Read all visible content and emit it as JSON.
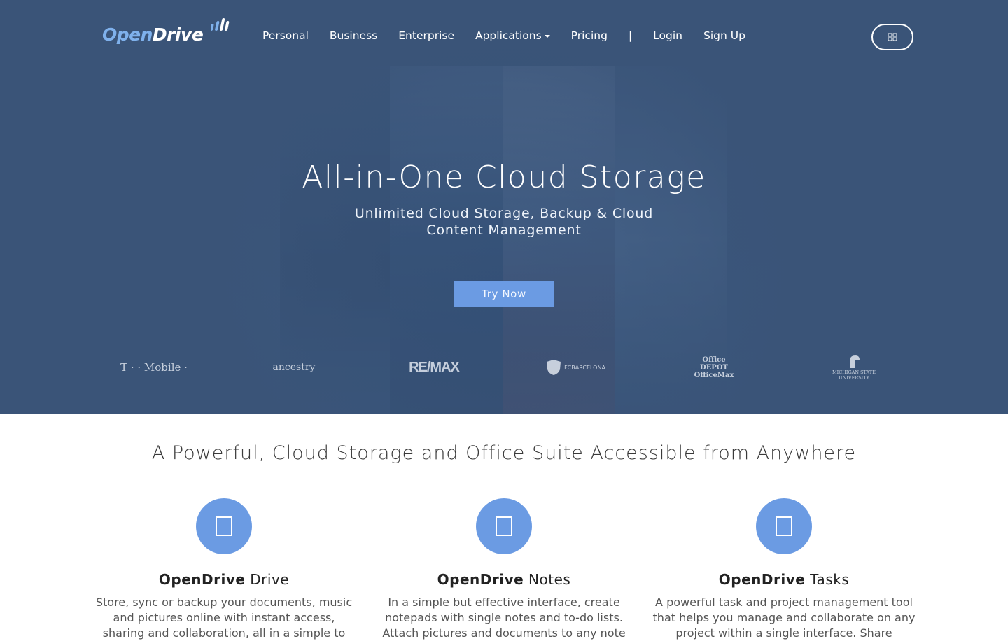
{
  "brand": {
    "logo_open": "Open",
    "logo_drive": "Drive"
  },
  "nav": {
    "items": [
      {
        "label": "Personal"
      },
      {
        "label": "Business"
      },
      {
        "label": "Enterprise"
      },
      {
        "label": "Applications"
      },
      {
        "label": "Pricing"
      },
      {
        "label": "|"
      },
      {
        "label": "Login"
      },
      {
        "label": "Sign Up"
      }
    ],
    "toggle_icon": "grid-icon"
  },
  "hero": {
    "title": "All-in-One Cloud Storage",
    "subtitle": "Unlimited Cloud Storage, Backup & Cloud Content Management",
    "cta": "Try Now"
  },
  "clients": [
    {
      "name": "T · · Mobile ·"
    },
    {
      "name": "ancestry"
    },
    {
      "name": "RE/MAX"
    },
    {
      "name": "FCBARCELONA"
    },
    {
      "name": "Office DEPOT OfficeMax"
    },
    {
      "name": "MICHIGAN STATE UNIVERSITY"
    }
  ],
  "features": {
    "title": "A Powerful, Cloud Storage and Office Suite Accessible from Anywhere",
    "items": [
      {
        "brand": "OpenDrive",
        "name": " Drive",
        "icon": "cloud-icon",
        "desc": "Store, sync or backup your documents, music and pictures online with instant access, sharing and collaboration, all in a simple to"
      },
      {
        "brand": "OpenDrive",
        "name": " Notes",
        "icon": "notes-icon",
        "desc": "In a simple but effective interface, create notepads with single notes and to-do lists. Attach pictures and documents to any note"
      },
      {
        "brand": "OpenDrive",
        "name": " Tasks",
        "icon": "tasks-icon",
        "desc": "A powerful task and project management tool that helps you manage and collaborate on any project within a single interface. Share"
      }
    ]
  },
  "colors": {
    "hero_bg": "#3a5478",
    "accent": "#6b9be3",
    "logo_open": "#7fb1ec"
  }
}
